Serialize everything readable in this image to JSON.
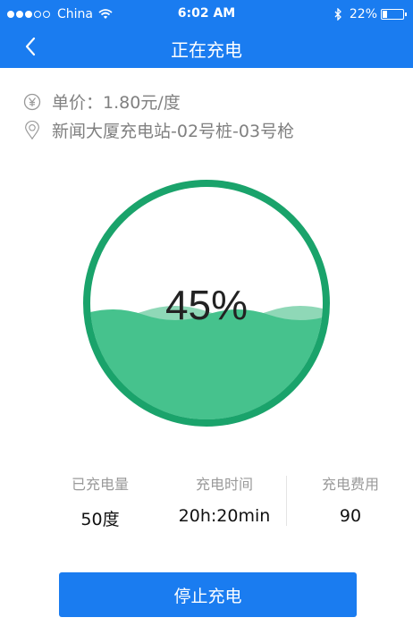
{
  "status_bar": {
    "carrier": "China",
    "time": "6:02 AM",
    "battery": "22%",
    "battery_level": 0.22,
    "signal_filled": 3,
    "signal_total": 5
  },
  "nav": {
    "title": "正在充电",
    "back_icon": "chevron-left-icon"
  },
  "info": {
    "price": "单价：1.80元/度",
    "price_icon": "yen-icon",
    "location": "新闻大厦充电站-02号桩-03号枪",
    "location_icon": "location-pin-icon"
  },
  "gauge": {
    "percent_label": "45%",
    "percent": 45,
    "color": "#1aa36b",
    "fill_color": "#46c28d",
    "wave_light_color": "#8fd8b7"
  },
  "stats": [
    {
      "label": "已充电量",
      "value": "50度"
    },
    {
      "label": "充电时间",
      "value": "20h:20min"
    },
    {
      "label": "充电费用",
      "value": "90"
    }
  ],
  "actions": {
    "stop_label": "停止充电"
  },
  "colors": {
    "primary": "#1a7cf0",
    "muted_text": "#808080"
  }
}
